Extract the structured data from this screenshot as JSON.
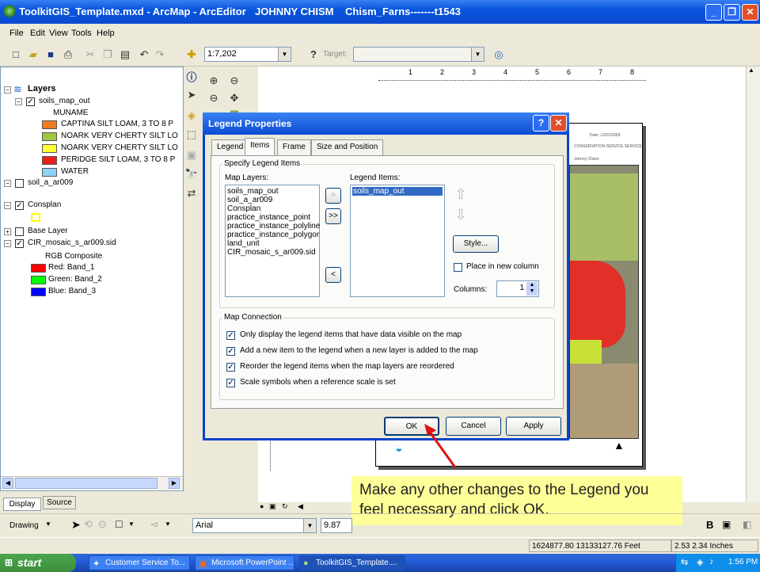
{
  "window": {
    "title": "ToolkitGIS_Template.mxd - ArcMap - ArcEditor",
    "user": "JOHNNY CHISM",
    "project": "Chism_Farns-------t1543"
  },
  "menu": [
    "File",
    "Edit",
    "View",
    "Tools",
    "Help"
  ],
  "toolbar": {
    "scale": "1:7,202",
    "target_label": "Target:"
  },
  "toc": {
    "root": "Layers",
    "layers": [
      {
        "name": "soils_map_out",
        "checked": true,
        "expanded": true
      },
      {
        "name": "soil_a_ar009",
        "checked": false,
        "expanded": true
      },
      {
        "name": "Consplan",
        "checked": true,
        "expanded": true
      },
      {
        "name": "Base Layer",
        "checked": false,
        "expanded": false
      },
      {
        "name": "CIR_mosaic_s_ar009.sid",
        "checked": true,
        "expanded": true
      }
    ],
    "field": "MUNAME",
    "legend": [
      {
        "label": "CAPTINA SILT LOAM, 3 TO 8 P",
        "color": "#f07c20"
      },
      {
        "label": "NOARK VERY CHERTY SILT LO",
        "color": "#9fc83e"
      },
      {
        "label": "NOARK VERY CHERTY SILT LO",
        "color": "#ffff33"
      },
      {
        "label": "PERIDGE SILT LOAM, 3 TO 8 P",
        "color": "#e8201a"
      },
      {
        "label": "WATER",
        "color": "#8fd3f5"
      }
    ],
    "rgb_label": "RGB Composite",
    "bands": [
      {
        "label": "Red:   Band_1",
        "color": "#ff0000"
      },
      {
        "label": "Green: Band_2",
        "color": "#00ff00"
      },
      {
        "label": "Blue:  Band_3",
        "color": "#0000ff"
      }
    ],
    "tabs": [
      "Display",
      "Source"
    ]
  },
  "dialog": {
    "title": "Legend Properties",
    "tabs": [
      "Legend",
      "Items",
      "Frame",
      "Size and Position"
    ],
    "group_specify": "Specify Legend Items",
    "map_layers_label": "Map Layers:",
    "map_layers": [
      "soils_map_out",
      "soil_a_ar009",
      "Consplan",
      "practice_instance_point",
      "practice_instance_polyline",
      "practice_instance_polygor",
      "land_unit",
      "CIR_mosaic_s_ar009.sid"
    ],
    "legend_items_label": "Legend Items:",
    "legend_items": [
      "soils_map_out"
    ],
    "btn_add": ">",
    "btn_add_all": ">>",
    "btn_remove": "<",
    "style_button": "Style...",
    "place_new_column": "Place in new column",
    "columns_label": "Columns:",
    "columns_value": "1",
    "group_connection": "Map Connection",
    "options": [
      "Only display the legend items that have data visible on the map",
      "Add a new item to the legend when a new layer is added to the map",
      "Reorder the legend items when the map layers are reordered",
      "Scale symbols when a reference scale is set"
    ],
    "ok": "OK",
    "cancel": "Cancel",
    "apply": "Apply"
  },
  "callout": "Make any other changes to the Legend you feel necessary and click OK.",
  "drawing": {
    "label": "Drawing",
    "font": "Arial",
    "size": "9.87"
  },
  "status": {
    "coords": "1624877.80  13133127.76 Feet",
    "size": "2.53  2.34 Inches"
  },
  "taskbar": {
    "start": "start",
    "tasks": [
      "Customer Service To...",
      "Microsoft PowerPoint ...",
      "ToolkitGIS_Template...."
    ],
    "time": "1:56 PM"
  },
  "ruler": [
    "1",
    "2",
    "3",
    "4",
    "5",
    "6",
    "7",
    "8"
  ],
  "page_text": {
    "date": "Date: 12/22/2009",
    "agency": "CONSERVATION SERVICE SERVICE",
    "person": "Johnny Chism"
  }
}
